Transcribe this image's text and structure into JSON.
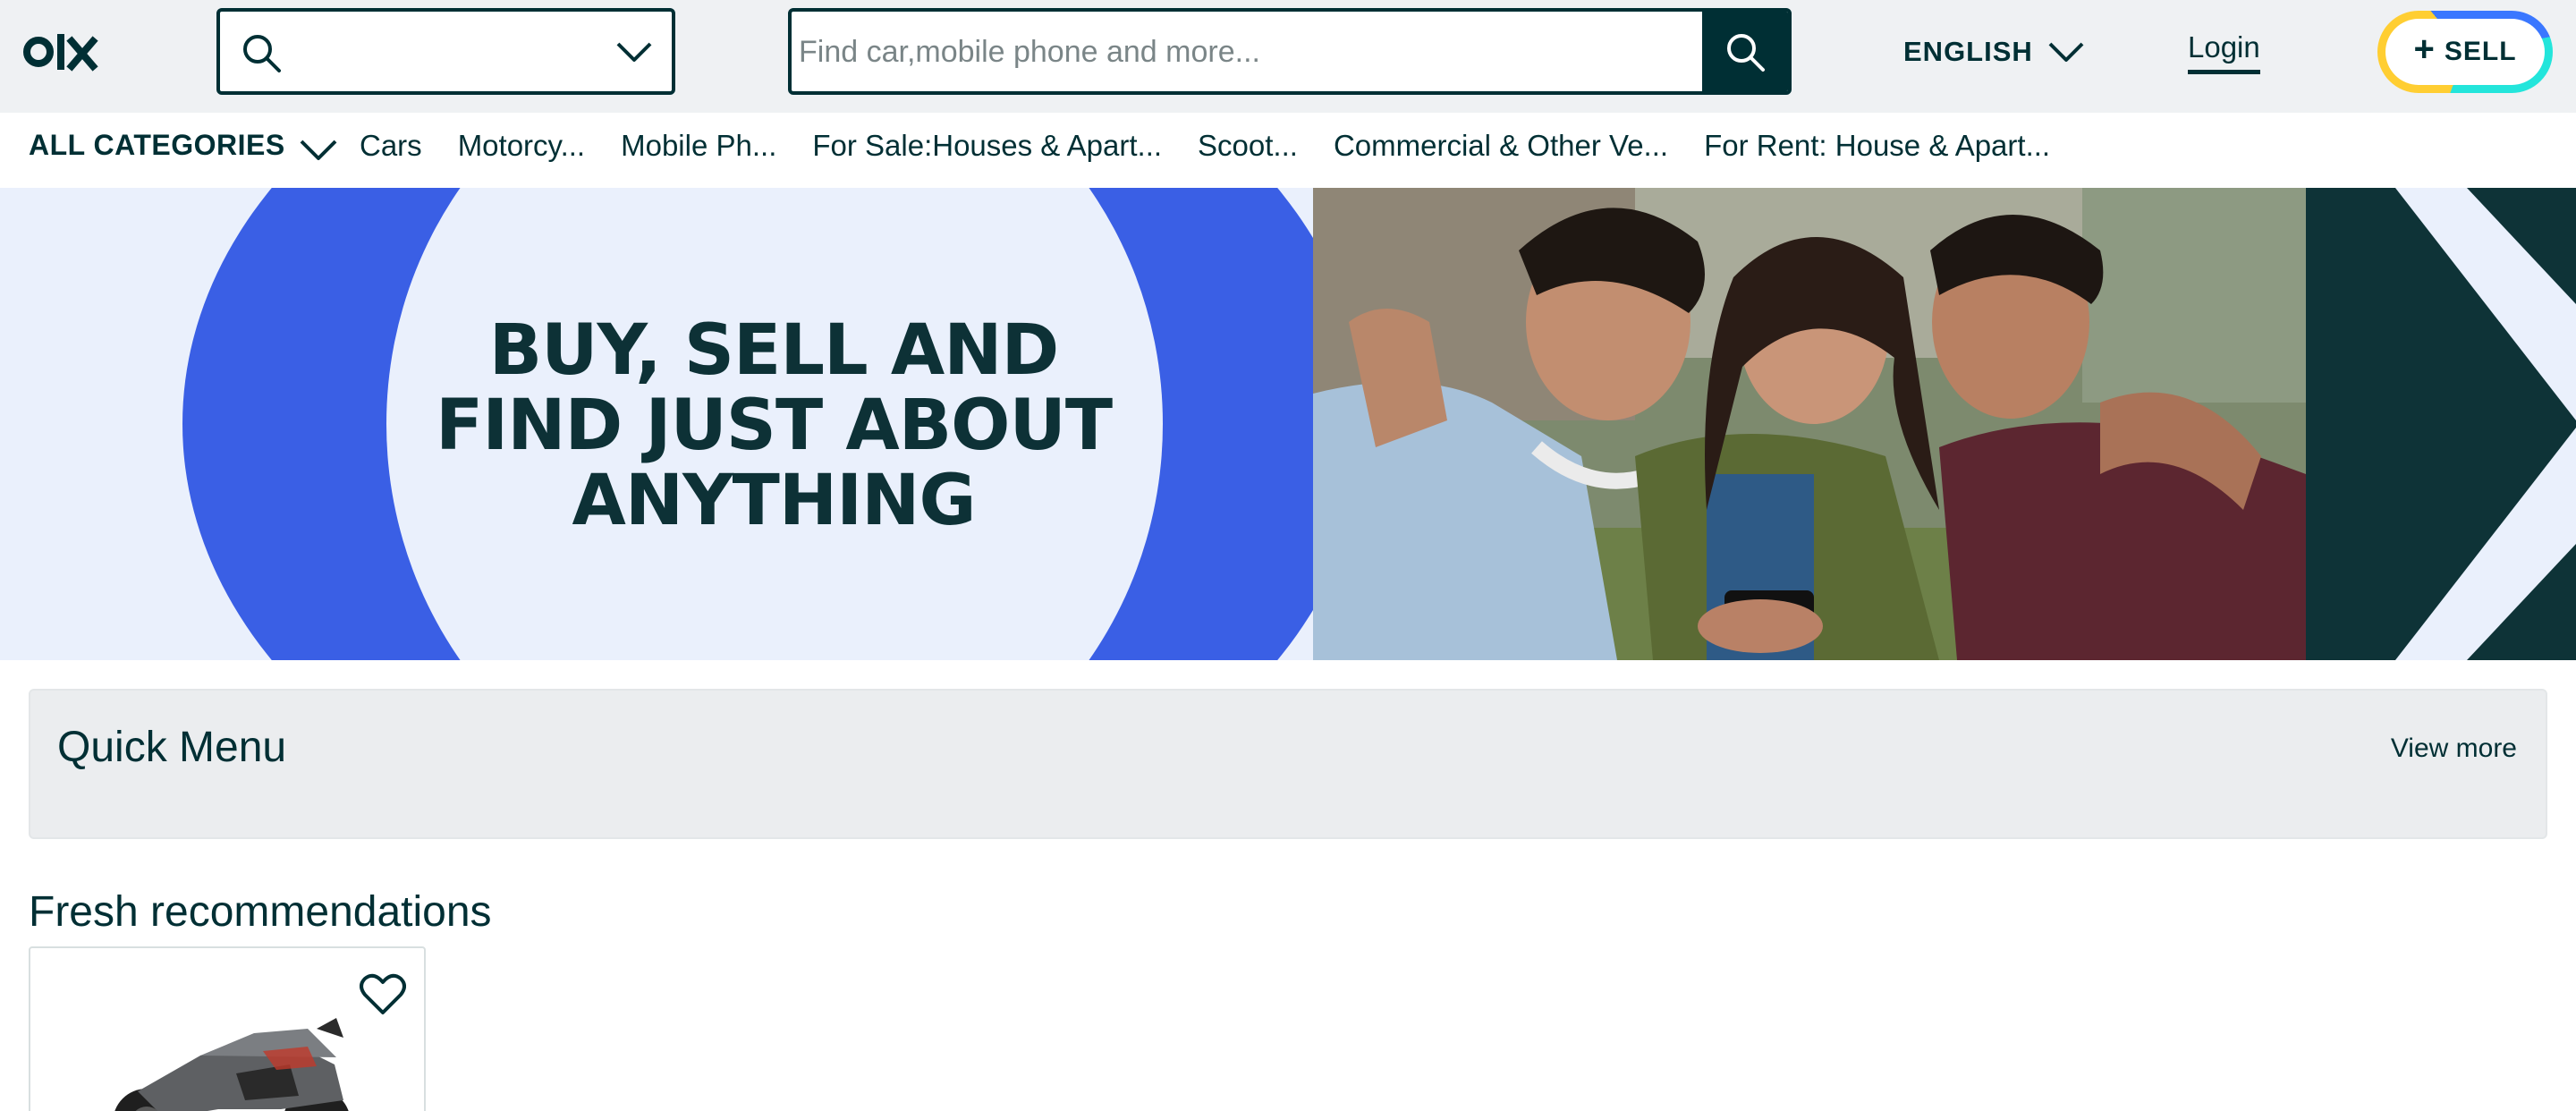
{
  "header": {
    "logo_text": "olx",
    "location": {
      "value": "",
      "icon": "search-icon",
      "dropdown_icon": "chevron-down-icon"
    },
    "search": {
      "placeholder": "Find car,mobile phone and more...",
      "button_icon": "search-icon"
    },
    "language": {
      "label": "ENGLISH",
      "icon": "chevron-down-icon"
    },
    "login_label": "Login",
    "sell": {
      "plus": "+",
      "label": "SELL"
    }
  },
  "categories": {
    "all_label": "ALL CATEGORIES",
    "items": [
      "Cars",
      "Motorcy...",
      "Mobile Ph...",
      "For Sale:Houses & Apart...",
      "Scoot...",
      "Commercial & Other Ve...",
      "For Rent: House & Apart..."
    ]
  },
  "banner": {
    "headline_lines": [
      "BUY, SELL AND",
      "FIND JUST ABOUT",
      "ANYTHING"
    ]
  },
  "quick_menu": {
    "title": "Quick Menu",
    "view_more": "View more"
  },
  "fresh": {
    "title": "Fresh recommendations",
    "cards": [
      {
        "fav_icon": "heart-icon",
        "image": "motorcycle-image"
      }
    ]
  },
  "colors": {
    "brand_dark": "#002f34",
    "header_bg": "#eff1f3",
    "banner_blue": "#3a5fe5",
    "banner_light": "#eaf0fc",
    "banner_teal": "#0e3337",
    "sell_yellow": "#ffce32",
    "sell_blue": "#3a77ff",
    "sell_cyan": "#23e5db"
  }
}
